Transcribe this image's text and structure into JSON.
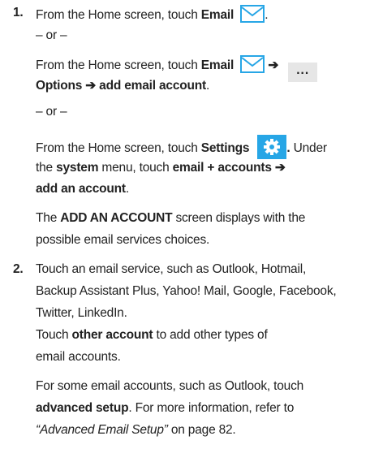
{
  "step1": {
    "number": "1.",
    "line1_prefix": "From the Home screen, touch ",
    "line1_bold": "Email",
    "line1_suffix": ".",
    "or1": "– or –",
    "line2_prefix": "From the Home screen, touch ",
    "line2_bold": "Email",
    "arrow": "➔",
    "more_icon": "...",
    "line3_bold_a": "Options",
    "line3_bold_b": "add email account",
    "line3_suffix": ".",
    "or2": "– or –",
    "line4_prefix": "From the Home screen, touch ",
    "line4_bold": "Settings",
    "line4_bold_suffix": ".",
    "line4_after": " Under",
    "line5_prefix": "the ",
    "line5_bold_a": "system",
    "line5_mid": " menu, touch ",
    "line5_bold_b": "email + accounts",
    "line6_bold": "add an account",
    "line6_suffix": ".",
    "line7_prefix": "The ",
    "line7_bold": "ADD AN ACCOUNT",
    "line7_suffix": " screen displays with the",
    "line8": "possible email services choices."
  },
  "step2": {
    "number": "2.",
    "line1": "Touch an email service, such as Outlook, Hotmail,",
    "line2": "Backup Assistant Plus, Yahoo! Mail, Google, Facebook,",
    "line3": "Twitter, LinkedIn.",
    "line4_prefix": "Touch ",
    "line4_bold": "other account",
    "line4_suffix": " to add other types of",
    "line5": "email accounts.",
    "line6": "For some email accounts, such as Outlook, touch",
    "line7_bold": "advanced setup",
    "line7_suffix": ". For more information, refer to",
    "line8_italic": "“Advanced Email Setup”",
    "line8_suffix": " on page 82."
  },
  "icons": {
    "email": "email-envelope-icon",
    "more": "more-options-icon",
    "settings": "settings-gear-icon"
  },
  "colors": {
    "accent": "#27a6e6",
    "text": "#222222",
    "more_bg": "#e6e6e6"
  }
}
